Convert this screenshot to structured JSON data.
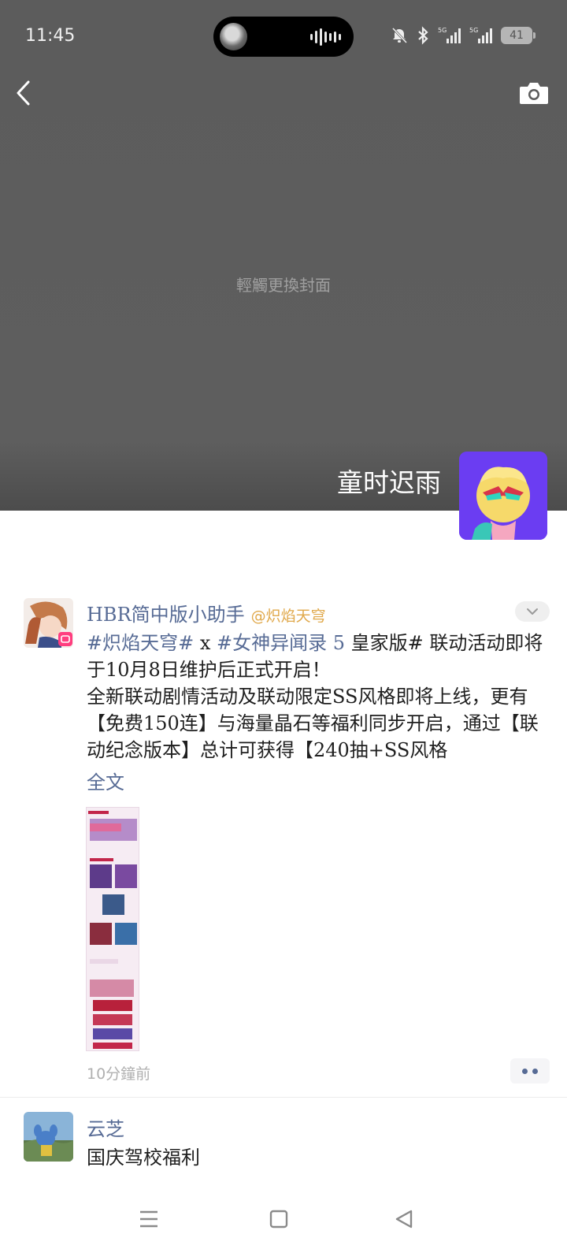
{
  "status_bar": {
    "time": "11:45",
    "battery": "41",
    "icons": [
      "mute-bell-icon",
      "bluetooth-icon",
      "5g-signal-icon",
      "5g-signal-icon",
      "battery-icon"
    ]
  },
  "cover": {
    "hint": "輕觸更換封面",
    "profile_name": "童时迟雨",
    "back_icon": "chevron-left-icon",
    "camera_icon": "camera-icon"
  },
  "posts": [
    {
      "author": "HBR简中版小助手",
      "mention": "@炽焰天穹",
      "body_hashtag_1": "#炽焰天穹#",
      "body_x": " x ",
      "body_hashtag_2": "#女神异闻录 5",
      "body_line_1_rest": " 皇家版# 联动活动即将于10月8日维护后正式开启！",
      "body_line_2": "全新联动剧情活动及联动限定SS风格即将上线，更有【免费150连】与海量晶石等福利同步开启，通过【联动纪念版本】总计可获得【240抽+SS风格",
      "full_text": "全文",
      "time": "10分鐘前"
    },
    {
      "author": "云芝",
      "body": "国庆驾校福利"
    }
  ],
  "nav": {
    "menu_icon": "menu-icon",
    "home_icon": "square-home-icon",
    "back_icon": "triangle-back-icon"
  }
}
